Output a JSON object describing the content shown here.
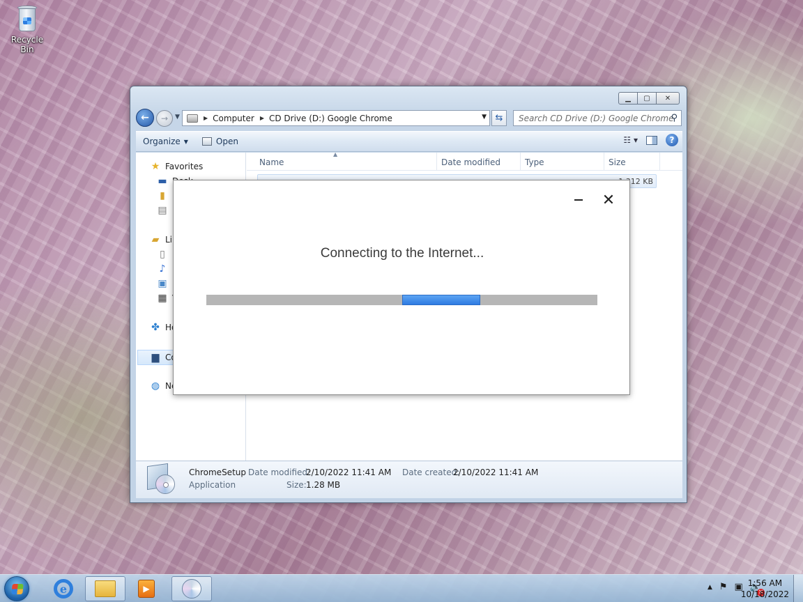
{
  "desktop": {
    "recycle_bin_label": "Recycle Bin"
  },
  "explorer": {
    "address": {
      "crumbs": [
        "Computer",
        "CD Drive (D:) Google Chrome"
      ]
    },
    "search_placeholder": "Search CD Drive (D:) Google Chrome",
    "toolbar": {
      "organize_label": "Organize",
      "open_label": "Open"
    },
    "navpane": {
      "favorites": "Favorites",
      "desktop": "Desk",
      "downloads": "D",
      "recent": "R",
      "libraries": "Libr",
      "documents": "D",
      "music": "N",
      "pictures": "P",
      "videos": "V",
      "homegroup": "Ho",
      "computer": "Co",
      "network": "Ne"
    },
    "columns": [
      "Name",
      "Date modified",
      "Type",
      "Size"
    ],
    "file": {
      "size": "1,312 KB"
    },
    "details": {
      "name": "ChromeSetup",
      "type": "Application",
      "date_modified_key": "Date modified:",
      "date_modified_val": "2/10/2022 11:41 AM",
      "date_created_key": "Date created:",
      "date_created_val": "2/10/2022 11:41 AM",
      "size_key": "Size:",
      "size_val": "1.28 MB"
    }
  },
  "installer": {
    "message": "Connecting to the Internet...",
    "progress_start_fraction": 0.5,
    "progress_width_fraction": 0.2
  },
  "taskbar": {
    "time": "1:56 AM",
    "date": "10/18/2022"
  },
  "colors": {
    "progress_fill": "#3a8ae8",
    "progress_track": "#b6b6b6",
    "toolbar_text": "#1e395b"
  }
}
